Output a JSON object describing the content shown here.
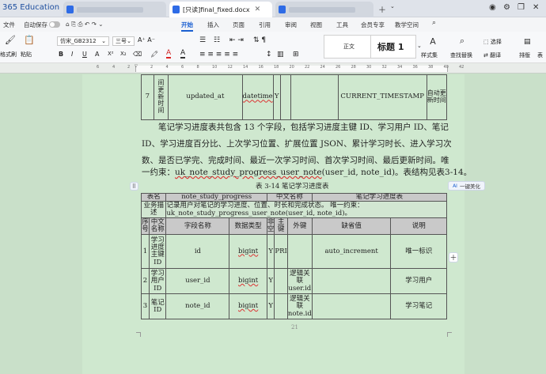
{
  "titlebar": {
    "brand": "365 Education",
    "tab_active_label": "[只读]final_fixed.docx"
  },
  "menu": {
    "file": "文件",
    "autosave": "自动保存",
    "items": [
      "开始",
      "插入",
      "页面",
      "引用",
      "审阅",
      "视图",
      "工具",
      "会员专享",
      "教学空间"
    ]
  },
  "ribbon": {
    "format_painter": "格式刷",
    "paste": "粘贴",
    "font_name": "仿宋_GB2312",
    "font_size": "三号",
    "normal_style": "正文",
    "heading_style": "标题 1",
    "style_set": "样式集",
    "find_replace": "查找替换",
    "select": "选择",
    "translate": "翻译",
    "layout": "排版",
    "more": "表"
  },
  "ruler": {
    "left_numbers": [
      "6",
      "4",
      "2"
    ],
    "right_numbers": [
      "2",
      "4",
      "6",
      "8",
      "10",
      "12",
      "14",
      "16",
      "18",
      "20",
      "22",
      "24",
      "26",
      "28",
      "30",
      "32",
      "34",
      "36",
      "38",
      "40",
      "42"
    ]
  },
  "table_top": {
    "row": {
      "index": "7",
      "cn_name_visible": "间\n更\n新\n时\n间",
      "field": "updated_at",
      "type": "datetime",
      "nullable": "Y",
      "default": "CURRENT_TIMESTAMP",
      "remark": "自动更\n新时间"
    }
  },
  "paragraph": {
    "line1": "笔记学习进度表共包含 13 个字段，包括学习进度主键 ID、学习用户 ID、笔记",
    "line2": "ID、学习进度百分比、上次学习位置、扩展位置 JSON、累计学习时长、进入学习次",
    "line3": "数、是否已学完、完成时间、最近一次学习时间、首次学习时间、最后更新时间。唯",
    "line4_prefix": "一约束：",
    "line4_underlined": "uk_note_study_progress_user_note",
    "line4_suffix": "(user_id, note_id)。表结构见表3-14。"
  },
  "caption": "表 3-14  笔记学习进度表",
  "ai_button": "一键美化",
  "table_bottom": {
    "meta": {
      "table_name_label": "表名",
      "table_name": "note_study_progress",
      "cn_name_label": "中文名称",
      "cn_name": "笔记学习进度表",
      "desc_label": "业务描\n述",
      "desc_line1": "记录用户对笔记的学习进度、位置、时长和完成状态。 唯一约束：",
      "desc_line2": "uk_note_study_progress_user_note(user_id, note_id)。"
    },
    "headers": [
      "序\n号",
      "中文\n名称",
      "字段名称",
      "数据类型",
      "非\n空",
      "主\n键",
      "外键",
      "缺省值",
      "说明"
    ],
    "rows": [
      {
        "index": "1",
        "cn": "学习\n进度\n主键\nID",
        "field": "id",
        "type": "bigint",
        "nn": "Y",
        "pk": "PRI",
        "fk": "",
        "default": "auto_increment",
        "note": "唯一标识"
      },
      {
        "index": "2",
        "cn": "学习\n用户\nID",
        "field": "user_id",
        "type": "bigint",
        "nn": "Y",
        "pk": "",
        "fk": "逻辑关\n联\nuser.id",
        "default": "",
        "note": "学习用户"
      },
      {
        "index": "3",
        "cn": "笔记\nID",
        "field": "note_id",
        "type": "bigint",
        "nn": "Y",
        "pk": "",
        "fk": "逻辑关\n联\nnote.id",
        "default": "",
        "note": "学习笔记"
      }
    ]
  },
  "page_number": "21",
  "colors": {
    "page_bg": "#cfe8cf",
    "accent_blue": "#1a5fd1",
    "header_gray": "#c9c9c9"
  }
}
